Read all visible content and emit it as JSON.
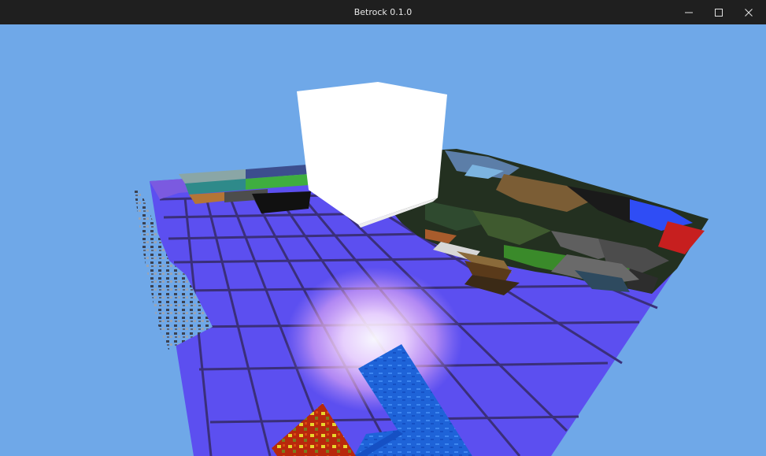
{
  "window": {
    "title": "Betrock 0.1.0",
    "controls": {
      "minimize_icon": "minimize-icon",
      "maximize_icon": "maximize-icon",
      "close_icon": "close-icon"
    }
  },
  "scene": {
    "sky_color": "#6fa8e8",
    "floor_color": "#5c4ff0",
    "grid_line_color": "#3a2f7a",
    "light_cube_color": "#ffffff",
    "light_glow_color": "#ffb8ff",
    "water_color": "#1e63d8",
    "lava_color": "#b8280c"
  }
}
